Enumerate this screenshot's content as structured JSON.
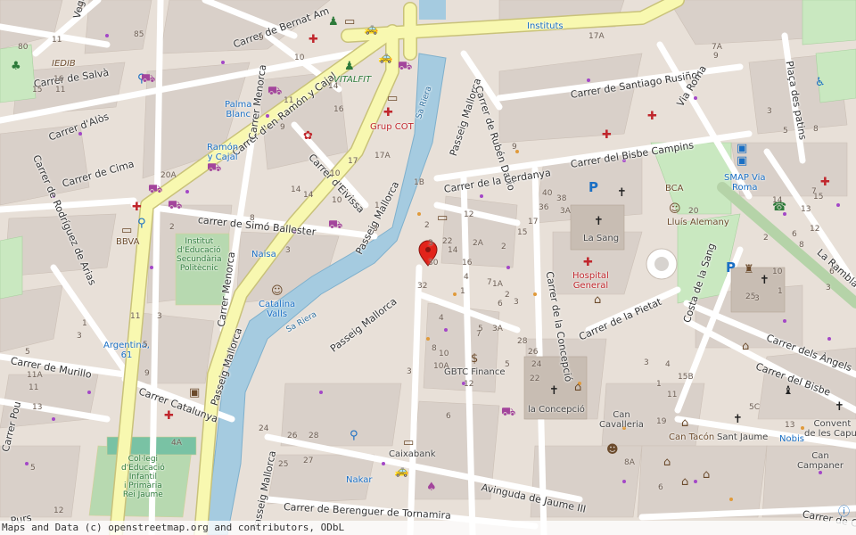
{
  "map": {
    "attribution": "Maps and Data (c) openstreetmap.org and contributors, ODbL",
    "colors": {
      "background": "#e8e0d8",
      "building": "#d9d0c9",
      "primary_road": "#f8f8b0",
      "primary_road_casing": "#c9c27a",
      "residential_road": "#ffffff",
      "river": "#a5cbe0",
      "park": "#c9e8c0",
      "school": "#ffffe5",
      "marker": "#e2231a"
    },
    "streets": [
      {
        "id": "salva",
        "text": "Carrer de Salvà"
      },
      {
        "id": "bernat",
        "text": "Carrer de Bernat Am"
      },
      {
        "id": "ramon",
        "text": "Carrer d'en Ramón y Cajal"
      },
      {
        "id": "alos",
        "text": "Carrer d'Alòs"
      },
      {
        "id": "cima",
        "text": "Carrer de Cima"
      },
      {
        "id": "rodriguez",
        "text": "Carrer de Rodríguez de Arias"
      },
      {
        "id": "menorca1",
        "text": "Carrer Menorca"
      },
      {
        "id": "menorca2",
        "text": "Carrer Menorca"
      },
      {
        "id": "eivissa",
        "text": "Carrer d'Eivissa"
      },
      {
        "id": "simo",
        "text": "carrer de Simó Ballester"
      },
      {
        "id": "mallorca_up",
        "text": "Passeig Mallorca"
      },
      {
        "id": "mallorca_low",
        "text": "Passeig Mallorca"
      },
      {
        "id": "mallorca_left",
        "text": "Passeig Mallorca"
      },
      {
        "id": "mallorca_bottom",
        "text": "Passeig Mallorca"
      },
      {
        "id": "mallorca_top",
        "text": "Passeig Mallorca"
      },
      {
        "id": "ruben",
        "text": "Carrer de Rubén Darío"
      },
      {
        "id": "cerdanya",
        "text": "Carrer de la Cerdanya"
      },
      {
        "id": "santiago",
        "text": "Carrer de Santiago Rusiñol"
      },
      {
        "id": "roma",
        "text": "Via Roma"
      },
      {
        "id": "bisbe_campins",
        "text": "Carrer del Bisbe Campins"
      },
      {
        "id": "patins",
        "text": "Plaça des patins"
      },
      {
        "id": "rambla",
        "text": "La Rambla"
      },
      {
        "id": "murillo",
        "text": "Carrer de Murillo"
      },
      {
        "id": "catalunya",
        "text": "Carrer Catalunya"
      },
      {
        "id": "pou",
        "text": "Carrer Pou"
      },
      {
        "id": "concepcio",
        "text": "Carrer de la Concepció"
      },
      {
        "id": "pietat",
        "text": "Carrer de la Pietat"
      },
      {
        "id": "sang",
        "text": "Costa de la Sang"
      },
      {
        "id": "angels",
        "text": "Carrer dels Àngels"
      },
      {
        "id": "bisbe",
        "text": "Carrer del Bisbe"
      },
      {
        "id": "jaume",
        "text": "Avinguda de Jaume III"
      },
      {
        "id": "berenguer",
        "text": "Carrer de Berenguer de Tornamira"
      },
      {
        "id": "purs",
        "text": "Purs"
      },
      {
        "id": "ca",
        "text": "Carrer de Ca"
      },
      {
        "id": "vega",
        "text": "Vega"
      },
      {
        "id": "sa_riera1",
        "text": "Sa Riera"
      },
      {
        "id": "sa_riera2",
        "text": "Sa Riera"
      }
    ],
    "places": [
      {
        "id": "instituts",
        "text": "Instituts",
        "color": "blue"
      },
      {
        "id": "iedib",
        "text": "IEDIB",
        "color": "brown"
      },
      {
        "id": "palma",
        "text": "Palma\nBlanc",
        "color": "blue"
      },
      {
        "id": "vitalfit",
        "text": "VITALFIT",
        "color": "green"
      },
      {
        "id": "grupcot",
        "text": "Grup COT",
        "color": "red"
      },
      {
        "id": "ramoncajal",
        "text": "Ramón\ny Cajal",
        "color": "blue"
      },
      {
        "id": "bbva",
        "text": "BBVA",
        "color": "brown"
      },
      {
        "id": "institut",
        "text": "Institut\nd'Educació\nSecundària\nPolitècnic",
        "color": "green"
      },
      {
        "id": "naisa",
        "text": "Naisa",
        "color": "blue"
      },
      {
        "id": "catalina",
        "text": "Catalina\nValls",
        "color": "blue"
      },
      {
        "id": "argentina",
        "text": "Argentina,\n61",
        "color": "blue"
      },
      {
        "id": "collegi",
        "text": "Col·legi\nd'Educació\nInfantil\ni Primària\nRei Jaume",
        "color": "green"
      },
      {
        "id": "gbtc",
        "text": "GBTC Finance",
        "color": "dark"
      },
      {
        "id": "caixabank",
        "text": "Caixabank",
        "color": "dark"
      },
      {
        "id": "nakar",
        "text": "Nakar",
        "color": "blue"
      },
      {
        "id": "lasang",
        "text": "La Sang",
        "color": "dark"
      },
      {
        "id": "hospital",
        "text": "Hospital\nGeneral",
        "color": "red"
      },
      {
        "id": "bca",
        "text": "BCA",
        "color": "brown"
      },
      {
        "id": "lluis",
        "text": "Lluís Alemany",
        "color": "brown"
      },
      {
        "id": "smap",
        "text": "SMAP Via\nRoma",
        "color": "blue"
      },
      {
        "id": "concepcio_p",
        "text": "la Concepció",
        "color": "dark"
      },
      {
        "id": "cancavalleria",
        "text": "Can\nCavalleria",
        "color": "dark"
      },
      {
        "id": "cantacon",
        "text": "Can Tacón",
        "color": "brown"
      },
      {
        "id": "santjaume",
        "text": "Sant Jaume",
        "color": "dark"
      },
      {
        "id": "nobis",
        "text": "Nobis",
        "color": "blue"
      },
      {
        "id": "convent",
        "text": "Convent\nde les Caput",
        "color": "dark"
      },
      {
        "id": "campaner",
        "text": "Can\nCampaner",
        "color": "dark"
      }
    ],
    "house_numbers": [
      "7",
      "85",
      "11",
      "80",
      "16",
      "15",
      "11",
      "9",
      "10",
      "14",
      "16",
      "11",
      "20A",
      "17",
      "14",
      "10",
      "9",
      "14",
      "1",
      "3",
      "17A",
      "2",
      "3",
      "10",
      "8",
      "11",
      "13",
      "3",
      "1",
      "5",
      "11",
      "5",
      "3",
      "9",
      "28",
      "26",
      "24",
      "27",
      "25",
      "22",
      "16",
      "12",
      "14",
      "7",
      "6",
      "4",
      "8",
      "10",
      "10A",
      "12",
      "3",
      "6",
      "2",
      "3",
      "2A",
      "2",
      "1A",
      "1",
      "3A",
      "7",
      "9",
      "40",
      "38",
      "36",
      "17",
      "15",
      "3A",
      "5",
      "28",
      "26",
      "24",
      "22",
      "7A",
      "9",
      "3",
      "5",
      "8",
      "14",
      "15",
      "13",
      "12",
      "6",
      "10",
      "3",
      "1",
      "20",
      "4",
      "15B",
      "11",
      "19",
      "17A",
      "1B",
      "2",
      "3",
      "30",
      "32",
      "4A",
      "11A",
      "13",
      "5C",
      "25",
      "7",
      "8",
      "6",
      "3",
      "2",
      "3",
      "1",
      "5",
      "12",
      "8A",
      "6",
      "4",
      "5",
      "3A"
    ],
    "marker": {
      "label": "selected-location"
    }
  }
}
